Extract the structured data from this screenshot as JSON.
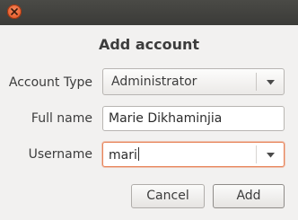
{
  "window": {
    "title": "Add account"
  },
  "form": {
    "account_type": {
      "label": "Account Type",
      "value": "Administrator"
    },
    "full_name": {
      "label": "Full name",
      "value": "Marie Dikhaminjia"
    },
    "username": {
      "label": "Username",
      "value": "mari"
    }
  },
  "buttons": {
    "cancel": "Cancel",
    "add": "Add"
  },
  "icons": {
    "close": "close-icon",
    "dropdown": "chevron-down-icon"
  },
  "colors": {
    "close_button": "#e0541c",
    "focus_border": "#e8845a",
    "titlebar": "#3f3f3c",
    "background": "#f2f1f0"
  }
}
